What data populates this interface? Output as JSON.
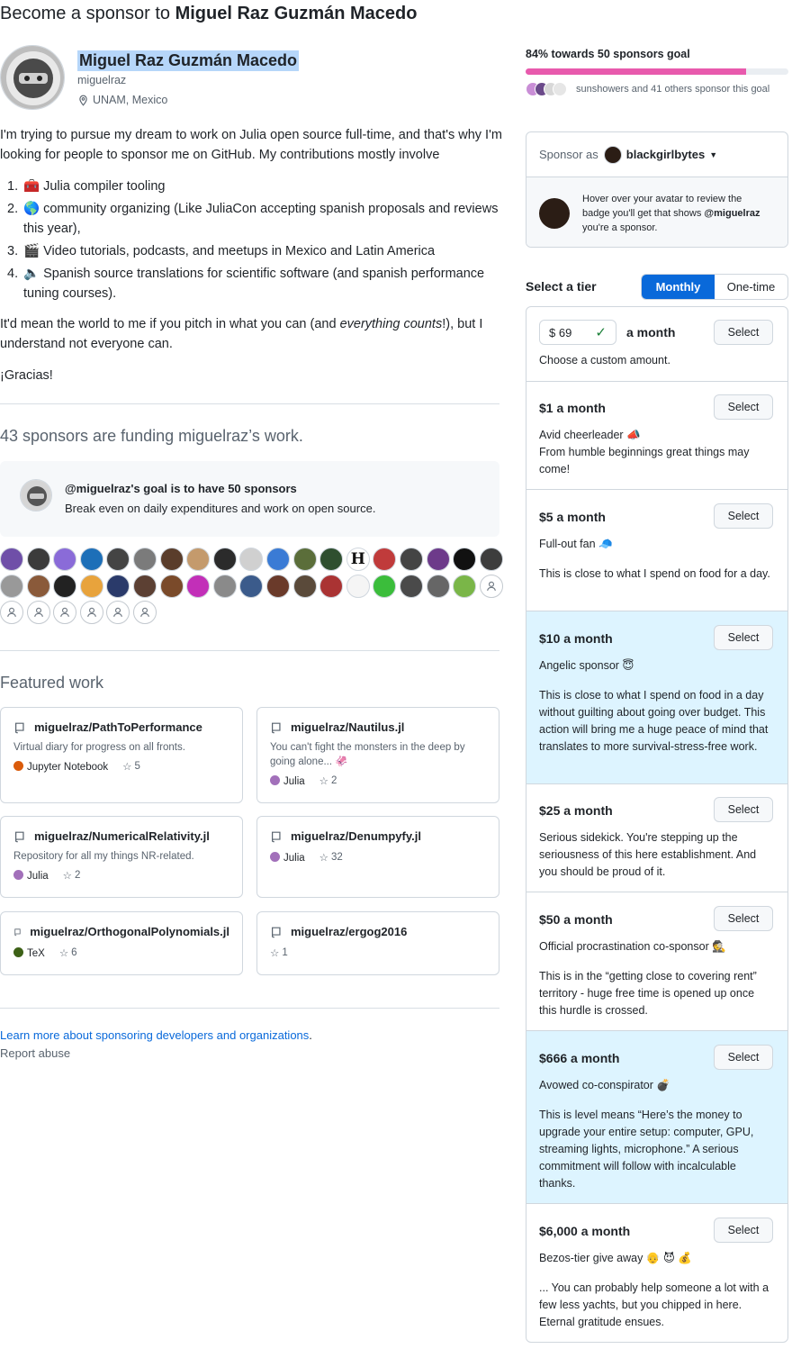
{
  "page_title": {
    "prefix": "Become a sponsor to",
    "name": "Miguel Raz Guzmán Macedo"
  },
  "profile": {
    "name": "Miguel Raz Guzmán Macedo",
    "login": "miguelraz",
    "location": "UNAM, Mexico"
  },
  "bio": {
    "intro": "I'm trying to pursue my dream to work on Julia open source full-time, and that's why I'm looking for people to sponsor me on GitHub. My contributions mostly involve",
    "items": [
      {
        "num": "1.",
        "emoji": "🧰",
        "text": "Julia compiler tooling"
      },
      {
        "num": "2.",
        "emoji": "🌎",
        "text": "community organizing (Like JuliaCon accepting spanish proposals and reviews this year),"
      },
      {
        "num": "3.",
        "emoji": "🎬",
        "text": "Video tutorials, podcasts, and meetups in Mexico and Latin America"
      },
      {
        "num": "4.",
        "emoji": "🔈",
        "text": "Spanish source translations for scientific software (and spanish performance tuning courses)."
      }
    ],
    "closing_a": "It'd mean the world to me if you pitch in what you can (and ",
    "closing_em": "everything counts",
    "closing_b": "!), but I understand not everyone can.",
    "gracias": "¡Gracias!"
  },
  "sponsors_heading": "43 sponsors are funding miguelraz’s work.",
  "goal": {
    "title": "@miguelraz's goal is to have 50 sponsors",
    "subtitle": "Break even on daily expenditures and work on open source."
  },
  "sponsor_avatars": {
    "filled_colors": [
      "#6f4fa8",
      "#3b3b3b",
      "#8a6bd8",
      "#1d6fb8",
      "#444",
      "#7b7b7b",
      "#5a3d2b",
      "#c49a6c",
      "#2b2b2b",
      "#d0d0d0",
      "#3a7bd5",
      "#5b6e3a",
      "#2f4f2f",
      "#fff",
      "#c03b3b",
      "#444",
      "#6d3a8a",
      "#111",
      "#3d3d3d",
      "#999",
      "#8a5a3a",
      "#222",
      "#e8a33c",
      "#2a3a6a",
      "#5c4033",
      "#7a4a2a",
      "#c22fb8",
      "#8a8a8a",
      "#3b5b8b",
      "#6a3a2a",
      "#5a4a3a",
      "#a33",
      "#f5f5f5",
      "#3bbd3b",
      "#4a4a4a",
      "#666",
      "#7ab648"
    ],
    "h_letter": "H",
    "empty_count": 7
  },
  "featured_heading": "Featured work",
  "repos": [
    {
      "name": "miguelraz/PathToPerformance",
      "desc": "Virtual diary for progress on all fronts.",
      "lang": "Jupyter Notebook",
      "lang_color": "#DA5B0B",
      "stars": "5"
    },
    {
      "name": "miguelraz/Nautilus.jl",
      "desc": "You can't fight the monsters in the deep by going alone... 🦑",
      "lang": "Julia",
      "lang_color": "#a270ba",
      "stars": "2"
    },
    {
      "name": "miguelraz/NumericalRelativity.jl",
      "desc": "Repository for all my things NR-related.",
      "lang": "Julia",
      "lang_color": "#a270ba",
      "stars": "2"
    },
    {
      "name": "miguelraz/Denumpyfy.jl",
      "desc": "",
      "lang": "Julia",
      "lang_color": "#a270ba",
      "stars": "32"
    },
    {
      "name": "miguelraz/OrthogonalPolynomials.jl",
      "desc": "",
      "lang": "TeX",
      "lang_color": "#3D6117",
      "stars": "6"
    },
    {
      "name": "miguelraz/ergog2016",
      "desc": "",
      "lang": "",
      "lang_color": "",
      "stars": "1"
    }
  ],
  "footer": {
    "learn_more": "Learn more about sponsoring developers and organizations",
    "report": "Report abuse"
  },
  "goal_progress": {
    "label": "84% towards 50 sponsors goal",
    "percent": 84,
    "sponsors_text": "sunshowers and 41 others sponsor this goal"
  },
  "sponsor_as": {
    "label": "Sponsor as",
    "account": "blackgirlbytes",
    "hint_a": "Hover over your avatar to review the badge you'll get that shows ",
    "hint_b": "@miguelraz",
    "hint_c": " you're a sponsor."
  },
  "tier_select": {
    "label": "Select a tier",
    "monthly": "Monthly",
    "one_time": "One-time"
  },
  "custom": {
    "currency": "$",
    "amount": "69",
    "suffix": "a month",
    "desc": "Choose a custom amount.",
    "button": "Select"
  },
  "tiers": [
    {
      "price": "$1 a month",
      "lines": [
        "Avid cheerleader 📣",
        "From humble beginnings great things may come!"
      ],
      "button": "Select"
    },
    {
      "price": "$5 a month",
      "lines": [
        "Full-out fan 🧢",
        "This is close to what I spend on food for a day."
      ],
      "button": "Select"
    },
    {
      "price": "$10 a month",
      "lines": [
        "Angelic sponsor 😇",
        "This is close to what I spend on food in a day without guilting about going over budget. This action will bring me a huge peace of mind that translates to more survival-stress-free work."
      ],
      "button": "Select"
    },
    {
      "price": "$25 a month",
      "lines": [
        "Serious sidekick. You're stepping up the seriousness of this here establishment. And you should be proud of it."
      ],
      "button": "Select"
    },
    {
      "price": "$50 a month",
      "lines": [
        "Official procrastination co-sponsor 🕵️",
        "This is in the “getting close to covering rent” territory - huge free time is opened up once this hurdle is crossed."
      ],
      "button": "Select"
    },
    {
      "price": "$666 a month",
      "lines": [
        "Avowed co-conspirator 💣",
        "This is level means “Here’s the money to upgrade your entire setup: computer, GPU, streaming lights, microphone.” A serious commitment will follow with incalculable thanks."
      ],
      "button": "Select"
    },
    {
      "price": "$6,000 a month",
      "lines": [
        "Bezos-tier give away 👴 😈 💰",
        "... You can probably help someone a lot with a few less yachts, but you chipped in here. Eternal gratitude ensues."
      ],
      "button": "Select"
    }
  ]
}
